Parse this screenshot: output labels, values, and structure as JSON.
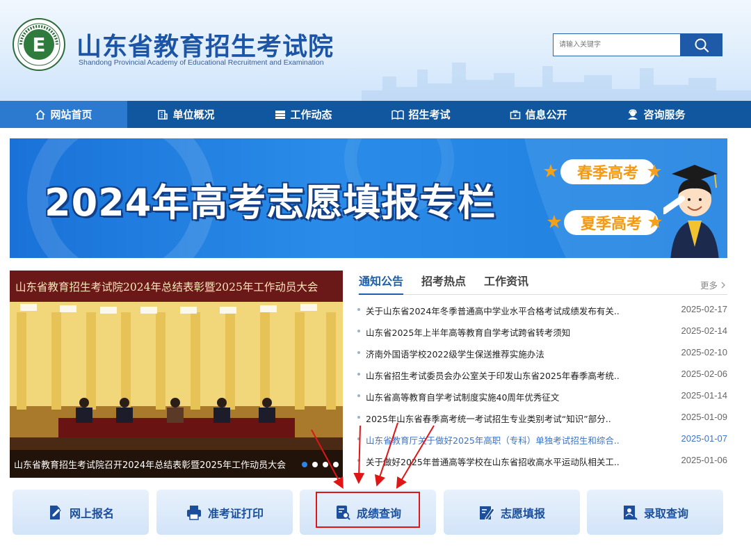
{
  "header": {
    "title": "山东省教育招生考试院",
    "subtitle": "Shandong Provincial Academy of Educational Recruitment and Examination",
    "logo_text": "Shandong Educational Admission & Examination",
    "search_placeholder": "请输入关键字"
  },
  "nav": {
    "items": [
      {
        "label": "网站首页",
        "icon": "home-icon"
      },
      {
        "label": "单位概况",
        "icon": "building-icon"
      },
      {
        "label": "工作动态",
        "icon": "news-icon"
      },
      {
        "label": "招生考试",
        "icon": "book-icon"
      },
      {
        "label": "信息公开",
        "icon": "briefcase-icon"
      },
      {
        "label": "咨询服务",
        "icon": "user-service-icon"
      }
    ],
    "active": 0
  },
  "banner": {
    "title": "2024年高考志愿填报专栏",
    "tag_spring": "春季高考",
    "tag_summer": "夏季高考"
  },
  "photo": {
    "caption_top": "山东省教育招生考试院2024年总结表彰暨2025年工作动员大会",
    "caption_bottom": "山东省教育招生考试院召开2024年总结表彰暨2025年工作动员大会",
    "slides": 4,
    "active_slide": 0
  },
  "news": {
    "tabs": [
      "通知公告",
      "招考热点",
      "工作资讯"
    ],
    "active_tab": 0,
    "more": "更多",
    "items": [
      {
        "title": "关于山东省2024年冬季普通高中学业水平合格考试成绩发布有关..",
        "date": "2025-02-17"
      },
      {
        "title": "山东省2025年上半年高等教育自学考试跨省转考须知",
        "date": "2025-02-14"
      },
      {
        "title": "济南外国语学校2022级学生保送推荐实施办法",
        "date": "2025-02-10"
      },
      {
        "title": "山东省招生考试委员会办公室关于印发山东省2025年春季高考统..",
        "date": "2025-02-06"
      },
      {
        "title": "山东省高等教育自学考试制度实施40周年优秀征文",
        "date": "2025-01-14"
      },
      {
        "title": "2025年山东省春季高考统一考试招生专业类别考试“知识”部分..",
        "date": "2025-01-09"
      },
      {
        "title": "山东省教育厅关于做好2025年高职（专科）单独考试招生和综合..",
        "date": "2025-01-07"
      },
      {
        "title": "关于做好2025年普通高等学校在山东省招收高水平运动队相关工..",
        "date": "2025-01-06"
      }
    ],
    "highlight_index": 6
  },
  "quick_links": [
    {
      "label": "网上报名",
      "icon": "register-icon"
    },
    {
      "label": "准考证打印",
      "icon": "printer-icon"
    },
    {
      "label": "成绩查询",
      "icon": "score-search-icon"
    },
    {
      "label": "志愿填报",
      "icon": "form-edit-icon"
    },
    {
      "label": "录取查询",
      "icon": "admission-search-icon"
    }
  ],
  "colors": {
    "brand": "#1d55a6",
    "nav": "#11579f",
    "nav_active": "#2c7ad0",
    "annotation": "#e01515"
  }
}
